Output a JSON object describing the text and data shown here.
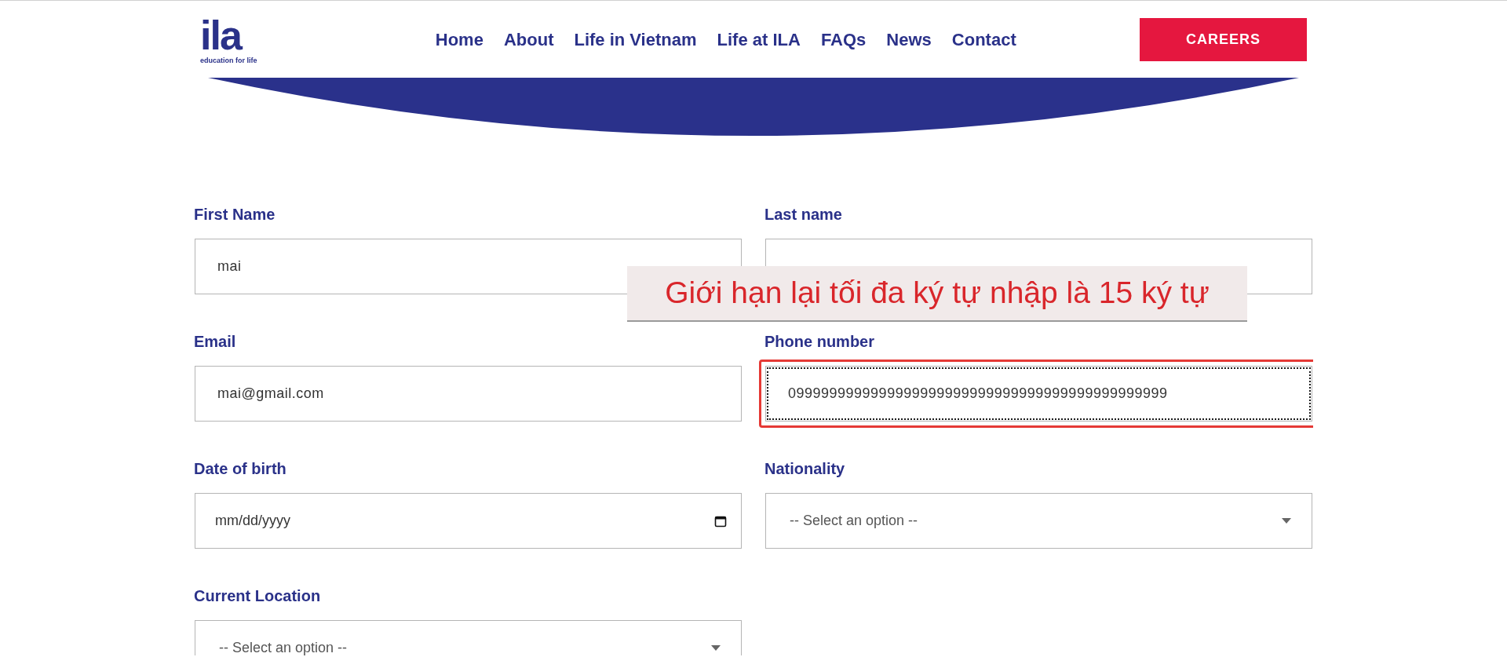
{
  "header": {
    "logo": {
      "wordmark": "ila",
      "tagline": "education for life"
    },
    "nav": [
      "Home",
      "About",
      "Life in Vietnam",
      "Life at ILA",
      "FAQs",
      "News",
      "Contact"
    ],
    "cta": "CAREERS"
  },
  "form": {
    "fields": [
      {
        "label": "First Name",
        "kind": "text",
        "value": "mai",
        "focused": false,
        "highlighted": false
      },
      {
        "label": "Last name",
        "kind": "text",
        "focused": false,
        "highlighted": false
      },
      {
        "label": "Email",
        "kind": "text",
        "value": "mai@gmail.com",
        "focused": false,
        "highlighted": false
      },
      {
        "label": "Phone number",
        "kind": "text",
        "value": "0999999999999999999999999999999999999999999999",
        "focused": true,
        "highlighted": true
      },
      {
        "label": "Date of birth",
        "kind": "date",
        "placeholder": "mm/dd/yyyy",
        "focused": false,
        "highlighted": false
      },
      {
        "label": "Nationality",
        "kind": "select",
        "placeholder": "-- Select an option --",
        "focused": false,
        "highlighted": false
      },
      {
        "label": "Current Location",
        "kind": "select",
        "placeholder": "-- Select an option --",
        "focused": false,
        "highlighted": false
      }
    ]
  },
  "annotation": {
    "text": "Giới hạn lại tối đa ký tự nhập là 15 ký tự"
  }
}
